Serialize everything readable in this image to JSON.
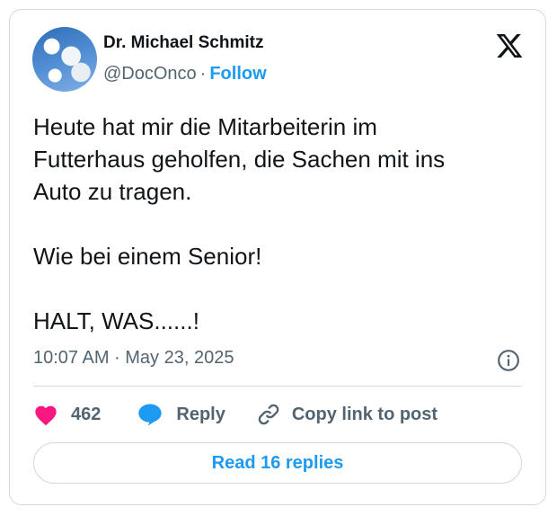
{
  "tweet": {
    "author_name": "Dr. Michael Schmitz",
    "handle": "@DocOnco",
    "separator": "·",
    "follow_label": "Follow",
    "body": "Heute hat mir die Mitarbeiterin im\nFutterhaus geholfen, die Sachen mit ins\nAuto zu tragen.\n\nWie bei einem Senior!\n\nHALT, WAS......!",
    "timestamp": "10:07 AM · May 23, 2025"
  },
  "actions": {
    "like_count": "462",
    "reply_label": "Reply",
    "copy_link_label": "Copy link to post"
  },
  "read_replies_label": "Read 16 replies",
  "icons": {
    "logo": "x-logo-icon",
    "info": "info-icon",
    "like": "heart-icon",
    "reply": "speech-bubble-icon",
    "copy": "link-icon"
  },
  "colors": {
    "accent": "#1d9bf0",
    "heart": "#f91880",
    "muted_text": "#536471",
    "text": "#0f1419",
    "border": "#cfd9de"
  }
}
